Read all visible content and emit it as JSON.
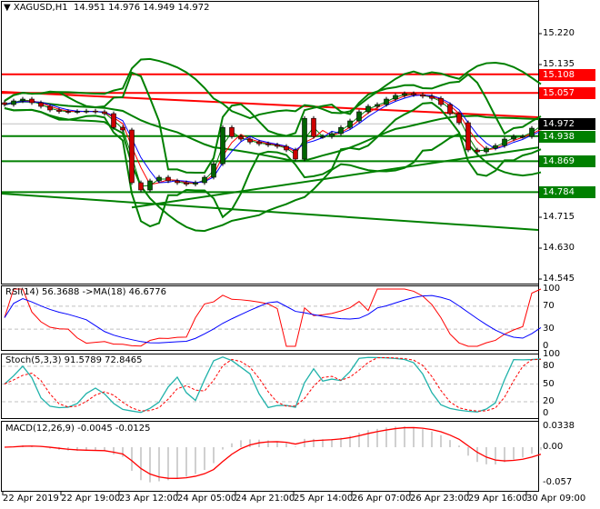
{
  "header": {
    "symbol": "XAGUSD,H1",
    "ohlc": "14.951 14.976 14.949 14.972"
  },
  "indicators": {
    "rsi": "RSI(14) 56.3688  ->MA(18) 46.6776",
    "stoch": "Stoch(5,3,3) 91.5789 72.8465",
    "macd": "MACD(12,26,9) -0.0045 -0.0125"
  },
  "colors": {
    "resistance": "#ff0000",
    "support": "#008000",
    "current": "#000000",
    "ma_fast": "#008000",
    "ma_mid": "#ff0000",
    "ma_slow": "#0000ff",
    "stoch_k": "#20b2aa",
    "hist": "#c0c0c0"
  },
  "chart_data": [
    {
      "type": "candlestick",
      "title": "XAGUSD,H1",
      "ylim": [
        14.545,
        15.25
      ],
      "y_ticks": [
        "15.220",
        "15.135",
        "14.715",
        "14.630",
        "14.545"
      ],
      "price_tags": [
        {
          "value": "15.108",
          "kind": "resistance"
        },
        {
          "value": "15.057",
          "kind": "resistance"
        },
        {
          "value": "14.972",
          "kind": "current"
        },
        {
          "value": "14.938",
          "kind": "support"
        },
        {
          "value": "14.869",
          "kind": "support"
        },
        {
          "value": "14.784",
          "kind": "support"
        }
      ],
      "close": [
        15.025,
        15.035,
        15.04,
        15.03,
        15.02,
        15.01,
        15.006,
        15.005,
        15.006,
        15.007,
        15.005,
        15.0,
        14.962,
        14.955,
        14.81,
        14.79,
        14.815,
        14.825,
        14.815,
        14.81,
        14.806,
        14.81,
        14.825,
        14.862,
        14.962,
        14.937,
        14.93,
        14.922,
        14.917,
        14.914,
        14.91,
        14.9,
        14.875,
        14.987,
        14.937,
        14.937,
        14.945,
        14.962,
        14.98,
        15.005,
        15.02,
        15.025,
        15.04,
        15.05,
        15.055,
        15.052,
        15.048,
        15.042,
        15.025,
        15.0,
        14.975,
        14.9,
        14.895,
        14.905,
        14.912,
        14.93,
        14.937,
        14.937,
        14.96,
        14.972
      ],
      "trendlines": [
        {
          "color": "red",
          "from": 15.06,
          "to": 14.99
        },
        {
          "color": "green",
          "from": 14.78,
          "to": 14.68
        },
        {
          "color": "green",
          "from_index": 14,
          "from": 14.742,
          "to": 14.907
        }
      ]
    },
    {
      "type": "line",
      "name": "RSI",
      "ylim": [
        0,
        100
      ],
      "y_ticks": [
        "100",
        "70",
        "30",
        "0"
      ],
      "levels": [
        70,
        30
      ]
    },
    {
      "type": "line",
      "name": "Stochastic",
      "ylim": [
        0,
        100
      ],
      "y_ticks": [
        "100",
        "80",
        "50",
        "20",
        "0"
      ],
      "levels": [
        80,
        50,
        20
      ]
    },
    {
      "type": "bar",
      "name": "MACD",
      "ylim": [
        -0.057,
        0.0338
      ],
      "y_ticks": [
        "0.0338",
        "0.00",
        "-0.057"
      ]
    }
  ],
  "x_ticks": [
    "22 Apr 2019",
    "22 Apr 19:00",
    "23 Apr 12:00",
    "24 Apr 05:00",
    "24 Apr 21:00",
    "25 Apr 14:00",
    "26 Apr 07:00",
    "26 Apr 23:00",
    "29 Apr 16:00",
    "30 Apr 09:00"
  ]
}
